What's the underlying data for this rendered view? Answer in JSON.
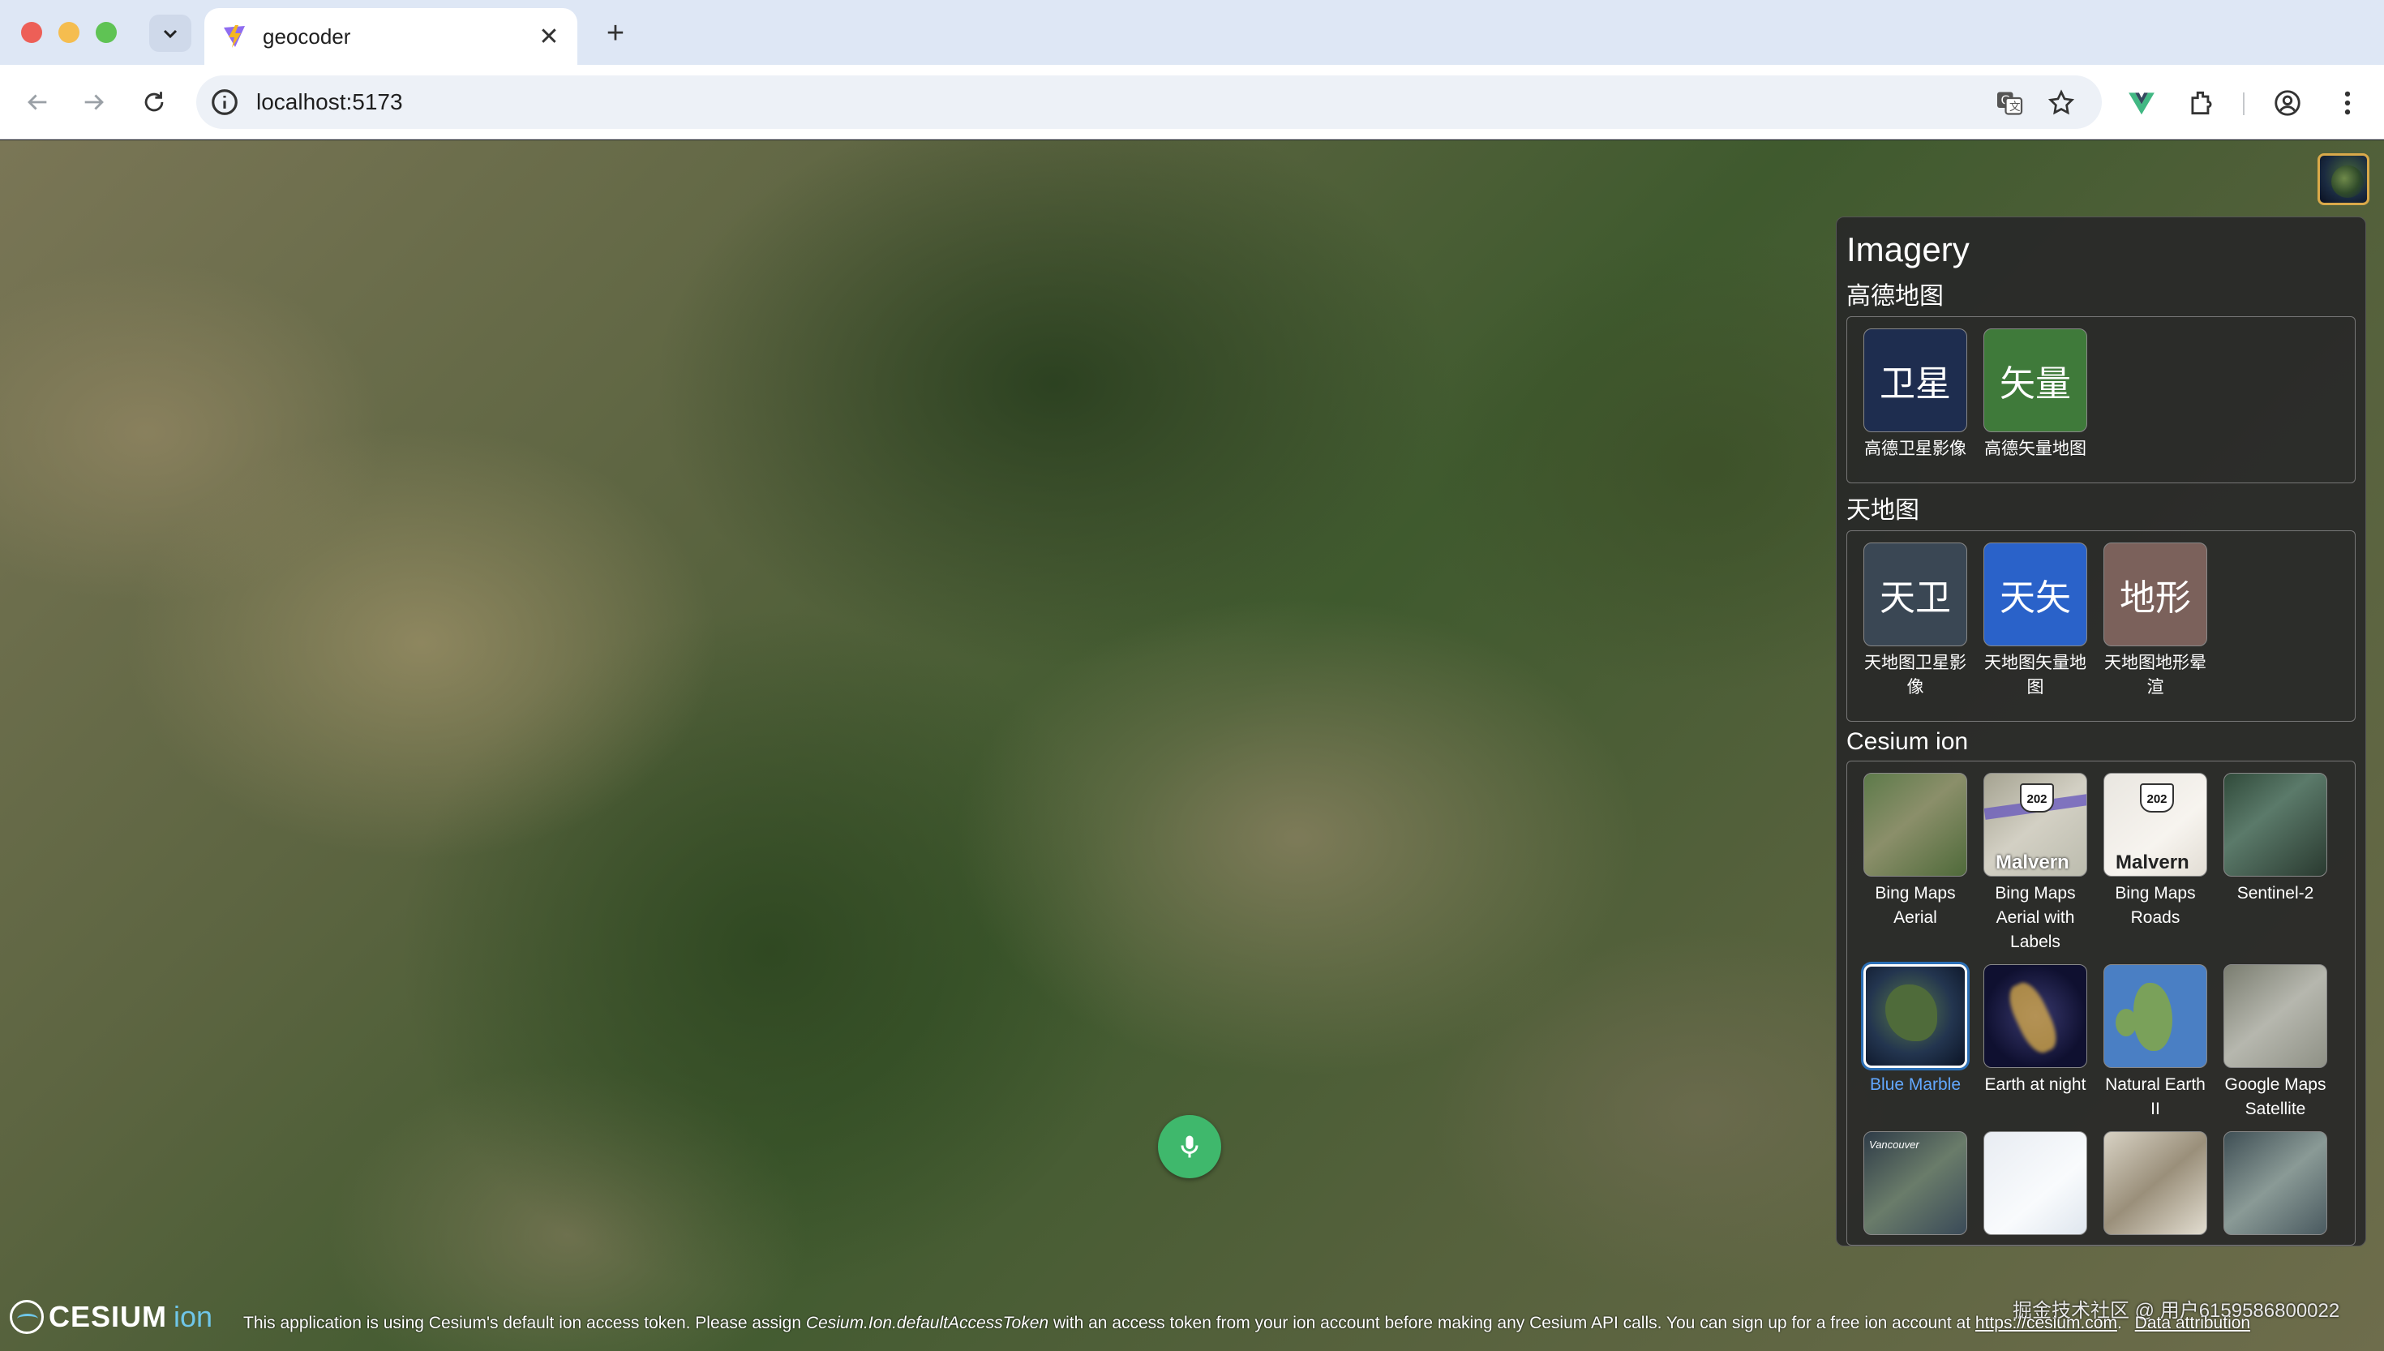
{
  "browser": {
    "tab_title": "geocoder",
    "url": "localhost:5173"
  },
  "panel": {
    "title": "Imagery",
    "sections": [
      {
        "title": "高德地图",
        "items": [
          {
            "thumb_text": "卫星",
            "label": "高德卫星影像"
          },
          {
            "thumb_text": "矢量",
            "label": "高德矢量地图"
          }
        ]
      },
      {
        "title": "天地图",
        "items": [
          {
            "thumb_text": "天卫",
            "label": "天地图卫星影像"
          },
          {
            "thumb_text": "天矢",
            "label": "天地图矢量地图"
          },
          {
            "thumb_text": "地形",
            "label": "天地图地形晕渲"
          }
        ]
      },
      {
        "title": "Cesium ion",
        "items": [
          {
            "label": "Bing Maps Aerial"
          },
          {
            "label": "Bing Maps Aerial with Labels",
            "shield": "202",
            "road_word": "Malvern"
          },
          {
            "label": "Bing Maps Roads",
            "shield": "202",
            "road_word": "Malvern"
          },
          {
            "label": "Sentinel-2"
          },
          {
            "label": "Blue Marble",
            "selected": true
          },
          {
            "label": "Earth at night"
          },
          {
            "label": "Natural Earth II"
          },
          {
            "label": "Google Maps Satellite"
          },
          {
            "label": "",
            "overlay_text": "Vancouver"
          },
          {
            "label": ""
          },
          {
            "label": ""
          },
          {
            "label": ""
          }
        ]
      }
    ]
  },
  "bottom": {
    "logo_word": "CESIUM",
    "logo_ion": "ion",
    "credit_pre": "This application is using Cesium's default ion access token. Please assign ",
    "credit_code": "Cesium.Ion.defaultAccessToken",
    "credit_post": " with an access token from your ion account before making any Cesium API calls. You can sign up for a free ion account at ",
    "credit_link": "https://cesium.com",
    "credit_end": ".",
    "data_attribution": "Data attribution",
    "watermark": "掘金技术社区 @ 用户6159586800022"
  },
  "icons": {
    "favicon": "vite-bolt-icon",
    "mic": "microphone-icon"
  },
  "colors": {
    "accent_selected": "#62a8ff",
    "mic_green": "#3fb86c",
    "cesium_ion_blue": "#6fc6e8"
  }
}
